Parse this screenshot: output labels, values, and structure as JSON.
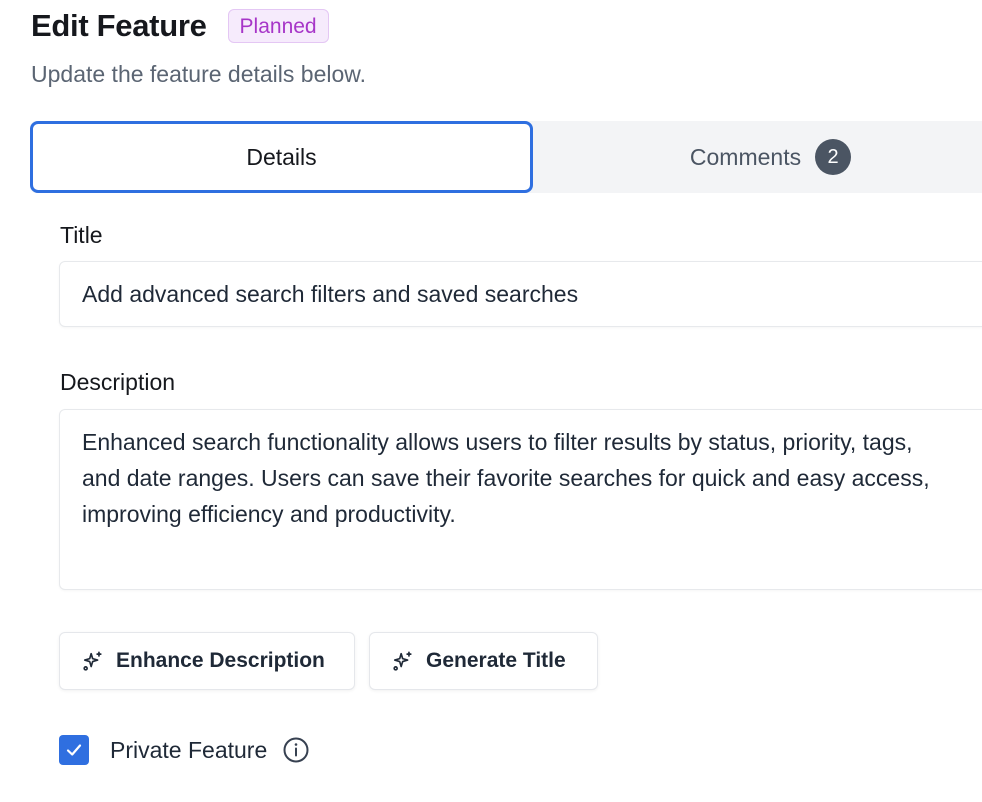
{
  "header": {
    "title": "Edit Feature",
    "status_badge": "Planned",
    "subtitle": "Update the feature details below."
  },
  "tabs": [
    {
      "label": "Details",
      "active": true
    },
    {
      "label": "Comments",
      "count": "2",
      "active": false
    }
  ],
  "form": {
    "title_label": "Title",
    "title_value": "Add advanced search filters and saved searches",
    "description_label": "Description",
    "description_value": "Enhanced search functionality allows users to filter results by status, priority, tags, and date ranges. Users can save their favorite searches for quick and easy access, improving efficiency and productivity.",
    "private_label": "Private Feature",
    "private_checked": true
  },
  "actions": {
    "enhance_label": "Enhance Description",
    "generate_label": "Generate Title"
  },
  "icons": {
    "ai_buttons": "sparkles-icon",
    "checkbox": "check-icon",
    "private_help": "info-icon"
  },
  "colors": {
    "accent": "#2f6fe0",
    "badge_bg": "#f6ebfc",
    "badge_text": "#a736c8",
    "count_badge_bg": "#4b5563"
  }
}
